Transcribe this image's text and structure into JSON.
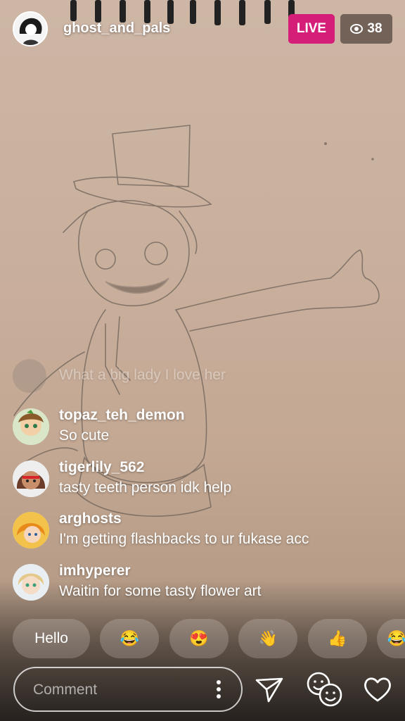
{
  "header": {
    "host_name": "ghost_and_pals",
    "live_label": "LIVE",
    "viewer_count": "38"
  },
  "comments": [
    {
      "user": "",
      "text": "What a big lady I love her",
      "faded": true
    },
    {
      "user": "topaz_teh_demon",
      "text": "So cute"
    },
    {
      "user": "tigerlily_562",
      "text": "tasty teeth person idk help"
    },
    {
      "user": "arghosts",
      "text": "I'm getting flashbacks to ur fukase acc"
    },
    {
      "user": "imhyperer",
      "text": "Waitin for some tasty flower art"
    }
  ],
  "quick_replies": [
    "Hello",
    "😂",
    "😍",
    "👋",
    "👍",
    "😂😂"
  ],
  "comment_input": {
    "placeholder": "Comment"
  },
  "colors": {
    "live": "#d51e77"
  }
}
